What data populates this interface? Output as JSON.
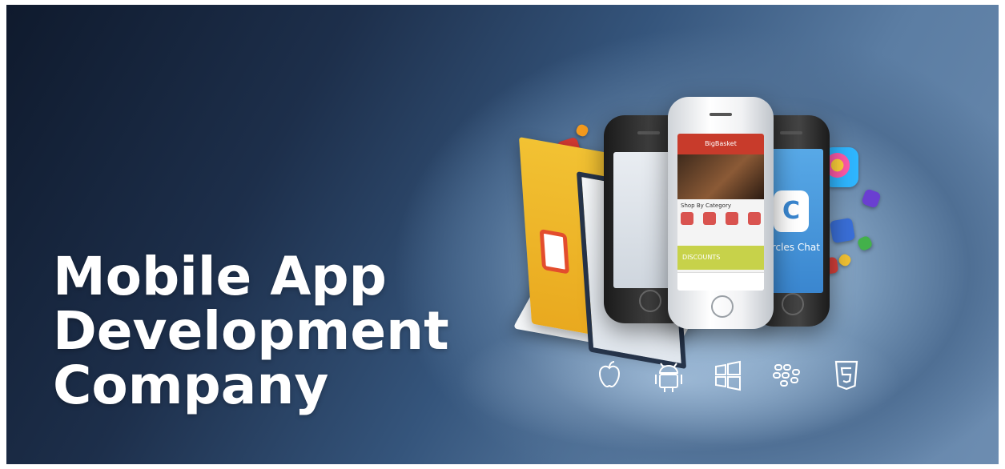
{
  "banner": {
    "headline": [
      "Mobile App",
      "Development",
      "Company"
    ],
    "colors": {
      "bg_dark": "#0f1a2d",
      "bg_light": "#b7cfe6",
      "headline": "#ffffff",
      "app_red": "#c83b2b",
      "app_blue": "#3a86cf",
      "tablet_yellow": "#f2c233",
      "accent_orange": "#f0881d"
    },
    "phone_screens": {
      "center_app_title": "BigBasket",
      "center_section_label": "Shop By Category",
      "center_offer_label": "DISCOUNTS",
      "right_app_name": "Circles Chat"
    },
    "platform_icons": [
      "apple-icon",
      "android-icon",
      "windows-icon",
      "blackberry-icon",
      "html5-icon"
    ]
  }
}
